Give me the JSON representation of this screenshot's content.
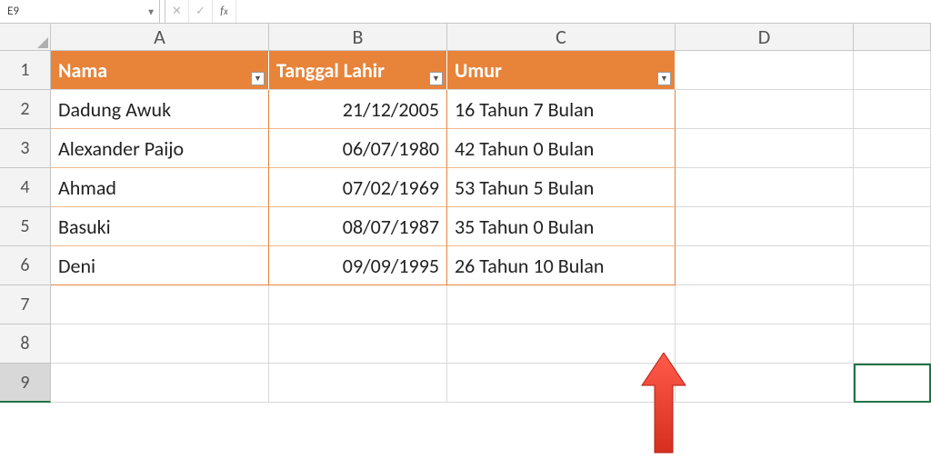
{
  "formula_bar": {
    "cell_ref": "E9",
    "formula": ""
  },
  "columns": [
    "A",
    "B",
    "C",
    "D"
  ],
  "rows": [
    "1",
    "2",
    "3",
    "4",
    "5",
    "6",
    "7",
    "8",
    "9"
  ],
  "table": {
    "headers": {
      "nama": "Nama",
      "tanggal": "Tanggal Lahir",
      "umur": "Umur"
    },
    "data": [
      {
        "nama": "Dadung Awuk",
        "tanggal": "21/12/2005",
        "umur": "16 Tahun 7 Bulan"
      },
      {
        "nama": "Alexander Paijo",
        "tanggal": "06/07/1980",
        "umur": "42 Tahun 0 Bulan"
      },
      {
        "nama": "Ahmad",
        "tanggal": "07/02/1969",
        "umur": "53 Tahun 5 Bulan"
      },
      {
        "nama": "Basuki",
        "tanggal": "08/07/1987",
        "umur": "35 Tahun 0 Bulan"
      },
      {
        "nama": "Deni",
        "tanggal": "09/09/1995",
        "umur": "26 Tahun 10 Bulan"
      }
    ]
  }
}
